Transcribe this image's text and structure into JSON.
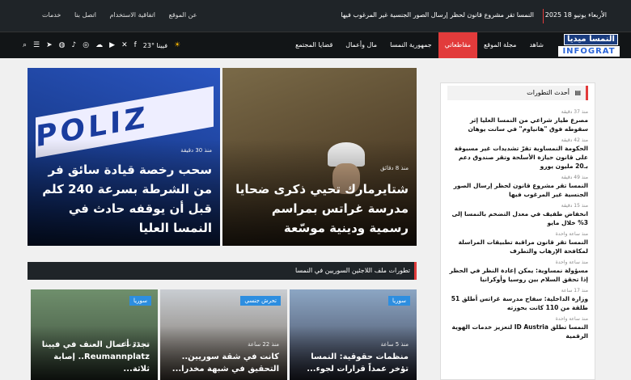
{
  "topbar": {
    "date": "الأربعاء يونيو 18 2025",
    "ticker": "النمسا تقر مشروع قانون لحظر إرسال الصور الجنسية غير المرغوب فيها",
    "links": [
      "عن الموقع",
      "اتفاقية الاستخدام",
      "اتصل بنا",
      "خدمات"
    ]
  },
  "logo": {
    "line1": "النمسا ميديا",
    "line2": "INFOGRAT"
  },
  "nav": {
    "items": [
      "شاهد",
      "مجلة الموقع",
      "مقاطعاتي",
      "جمهورية النمسا",
      "مال وأعمال",
      "قضايا المجتمع"
    ],
    "weather": "23° فيينا",
    "icons": [
      "sun-icon",
      "facebook-icon",
      "x-icon",
      "youtube-icon",
      "soundcloud-icon",
      "instagram-icon",
      "tiktok-icon",
      "whatsapp-icon",
      "telegram-icon",
      "menu-icon",
      "search-icon"
    ]
  },
  "hero": [
    {
      "meta": "منذ 8 دقائق",
      "title": "شتايرمارك تحيي ذكرى ضحايا مدرسة غراتس بمراسم رسمية ودينية موسّعة"
    },
    {
      "meta": "منذ 30 دقيقة",
      "title": "سحب رخصة قيادة سائق فر من الشرطة بسرعة 240 كلم قبل أن يوقفه حادث في النمسا العليا",
      "image_text": "POLIZ"
    }
  ],
  "section": {
    "title": "تطورات ملف اللاجئين السوريين في النمسا"
  },
  "small": [
    {
      "badge": "سوريا",
      "meta": "منذ 5 ساعة",
      "title": "منظمات حقوقية: النمسا تؤخر عمداً قرارات لجوء..."
    },
    {
      "badge": "تحرش جنسي",
      "meta": "منذ 22 ساعة",
      "title": "كانت في شقة سوريين.. التحقيق في شبهة مخدرا..."
    },
    {
      "badge": "سوريا",
      "meta": "منذ 23 ساعة",
      "title": "تجدد أعمال العنف في فيينا Reumannplatz.. إصابة ثلاثة..."
    }
  ],
  "sidebar": {
    "title": "أحدث التطورات",
    "items": [
      {
        "time": "منذ 37 دقيقة",
        "text": "مصرع طيار شراعي من النمسا العليا إثر سقوطه فوق \"هانياوم\" في سانت يوهان"
      },
      {
        "time": "منذ 42 دقيقة",
        "text": "الحكومة النمساوية تقرّ تشديدات غير مسبوقة على قانون حيازة الأسلحة وتقر صندوق دعم بـ20 مليون يورو"
      },
      {
        "time": "منذ 49 دقيقة",
        "text": "النمسا تقر مشروع قانون لحظر إرسال الصور الجنسية غير المرغوب فيها"
      },
      {
        "time": "منذ 15 دقيقة",
        "text": "انخفاض طفيف في معدل التضخم بالنمسا إلى 3% خلال مايو"
      },
      {
        "time": "منذ ساعة واحدة",
        "text": "النمسا تقر قانون مراقبة تطبيقات المراسلة لمكافحة الإرهاب والتطرف"
      },
      {
        "time": "منذ ساعة واحدة",
        "text": "مسؤولة نمساوية: يمكن إعادة النظر في الحظر إذا تحقق السلام بين روسيا وأوكرانيا"
      },
      {
        "time": "منذ 17 ساعة",
        "text": "وزارة الداخلية: سفاح مدرسة غراتس أطلق 51 طلقة من 110 كانت بحوزته"
      },
      {
        "time": "منذ ساعة واحدة",
        "text": "النمسا تطلق ID Austria لتعزيز خدمات الهوية الرقمية"
      }
    ]
  }
}
